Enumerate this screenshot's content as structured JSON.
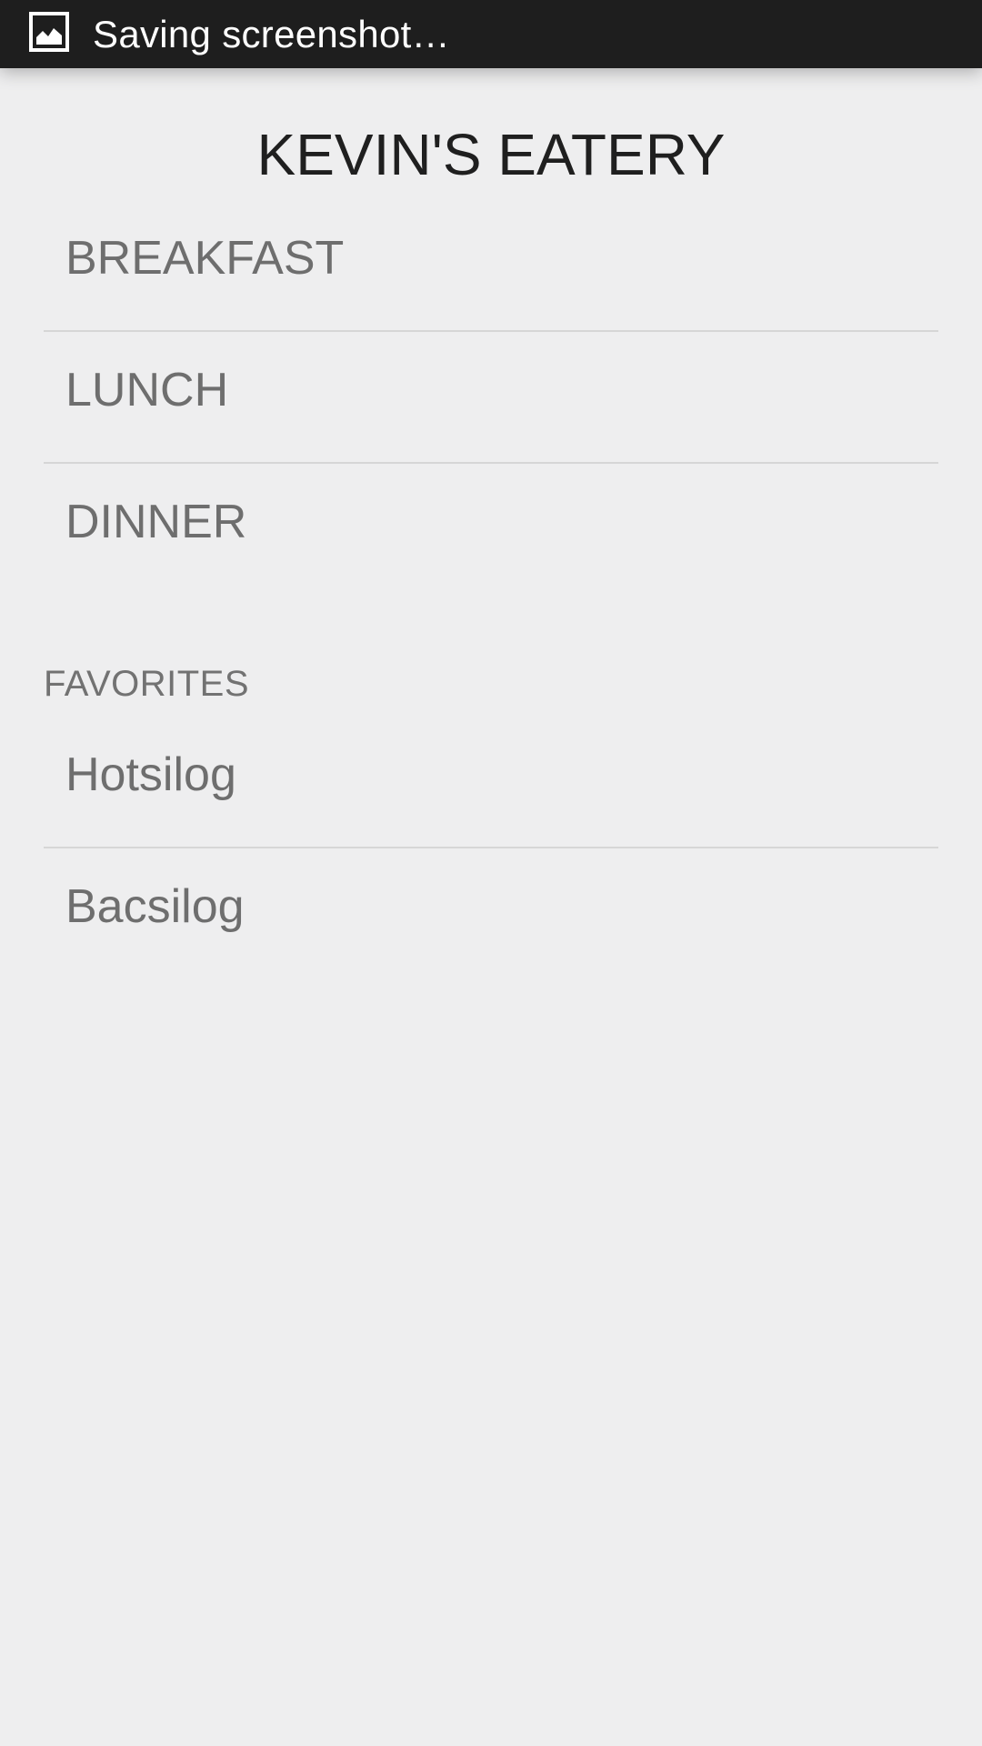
{
  "status_bar": {
    "icon": "image-icon",
    "text": "Saving screenshot…"
  },
  "header": {
    "title": "KEVIN'S EATERY"
  },
  "menu": {
    "items": [
      {
        "label": "BREAKFAST"
      },
      {
        "label": "LUNCH"
      },
      {
        "label": "DINNER"
      }
    ]
  },
  "favorites": {
    "header": "FAVORITES",
    "items": [
      {
        "label": "Hotsilog"
      },
      {
        "label": "Bacsilog"
      }
    ]
  },
  "colors": {
    "background": "#eeeeef",
    "status_bar": "#1e1e1e",
    "item_text": "#6e6e6e",
    "divider": "#d6d6d6"
  }
}
